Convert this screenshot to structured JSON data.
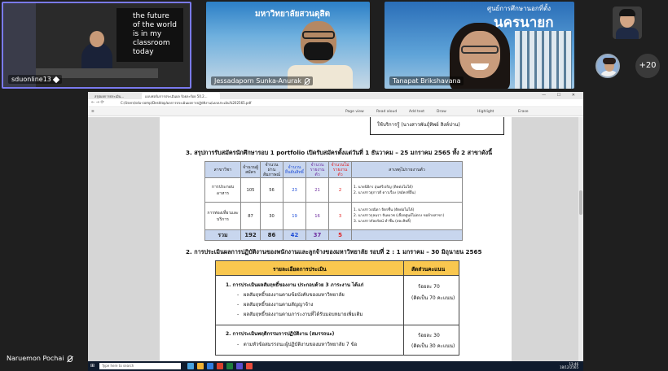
{
  "participants": {
    "tile1": {
      "name": "sduonline13",
      "board_text": "the future\nof the world\nis in my\nclassroom\ntoday"
    },
    "tile2": {
      "name": "Jessadaporn Sunka-Anurak",
      "banner": "มหาวิทยาลัยสวนดุสิต"
    },
    "tile3": {
      "name": "Tanapat Brikshavana",
      "banner_small": "ศูนย์การศึกษานอกที่ตั้ง",
      "banner_big": "นครนายก"
    },
    "more_count": "+20",
    "bottom_name": "Naruemon Pochai"
  },
  "browser": {
    "tabs": [
      "สรุปผลการประเมิน...",
      "แบบฟอร์มการประเมินผล ร้อยละร้อย 50.2..."
    ],
    "url": "C:/Users/sdu-comp/Desktop/ผลการประเมินผลการปฏิบัติงาน/แบบประเมิน%202565.pdf",
    "toolbar": [
      "Page view",
      "Read aloud",
      "Add text",
      "Draw",
      "Highlight",
      "Erase"
    ]
  },
  "document": {
    "box_text": "ใช้บริการรู้ (นางสาวพันธุ์ทิพย์ สิงห์ปาน)",
    "heading1": "3.  สรุปการรับสมัครนักศึกษารอบ 1 portfolio เปิดรับสมัครตั้งแต่วันที่ 1 ธันวาคม – 25 มกราคม 2565 ทั้ง 2 สาขาดังนี้",
    "table1": {
      "headers": [
        "สาขาวิชา",
        "จำนวนผู้สมัคร",
        "จำนวนผ่านสัมภาษณ์",
        "จำนวนยืนยันสิทธิ์",
        "จำนวนรายงานตัว",
        "จำนวนไม่รายงานตัว",
        "สาเหตุไม่รายงานตัว"
      ],
      "rows": [
        {
          "major": "การประกอบอาหาร",
          "applicants": "105",
          "passed": "56",
          "confirmed": "23",
          "reported": "21",
          "not_reported": "2",
          "reasons": [
            "1. นายนิธิกร อุ่นศรีเจริญ (ติดต่อไม่ได้)",
            "2. นางสาวสุภาวดี ดาวเรือง (สมัครที่อื่น)"
          ]
        },
        {
          "major": "การท่องเที่ยวและบริการ",
          "applicants": "87",
          "passed": "30",
          "confirmed": "19",
          "reported": "16",
          "not_reported": "3",
          "reasons": [
            "1. นางสาวปณิดา จิตรชื่น (ติดต่อไม่ได้)",
            "2. นางสาวกุลนรา จันทเวช (เลือกศูนย์ไม่ตรง ขอย้ายสาขา)",
            "3. นางสาวกัลยรัตน์ คำชื่น (สละสิทธิ์)"
          ]
        }
      ],
      "total": {
        "label": "รวม",
        "applicants": "192",
        "passed": "86",
        "confirmed": "42",
        "reported": "37",
        "not_reported": "5"
      }
    },
    "heading2": "2.  การประเมินผลการปฏิบัติงานของพนักงานและลูกจ้างของมหาวิทยาลัย รอบที่ 2  : 1 มกราคม – 30 มิถุนายน 2565",
    "table2": {
      "col1": "รายละเอียดการประเมิน",
      "col2": "สัดส่วนคะแนน",
      "item1_title": "1.   การประเมินผลสัมฤทธิ์ของงาน ประกอบด้วย 3 ภาระงาน ได้แก่",
      "item1_bullets": [
        "ผลสัมฤทธิ์ของงานตามข้อบังคับของมหาวิทยาลัย",
        "ผลสัมฤทธิ์ของงานตามสัญญาจ้าง",
        "ผลสัมฤทธิ์ของงานตามภาระงานที่ได้รับมอบหมายเพิ่มเติม"
      ],
      "item1_score": "ร้อยละ 70",
      "item1_score_note": "(คิดเป็น 70 คะแนน)",
      "item2_title": "2.   การประเมินพฤติกรรมการปฏิบัติงาน (สมรรถนะ)",
      "item2_bullet": "ตามหัวข้อสมรรถนะผู้ปฏิบัติงานของมหาวิทยาลัย 7 ข้อ",
      "item2_score": "ร้อยละ 30",
      "item2_score_note": "(คิดเป็น 30 คะแนน)"
    }
  },
  "taskbar": {
    "search_placeholder": "Type here to search",
    "time": "13:46",
    "date": "18/12/2565"
  },
  "colors": {
    "header_blue": "#c8d6ee",
    "table2_header": "#f9c74f",
    "purple": "#7030a0",
    "red": "#e02020",
    "blue": "#1f4ed8"
  }
}
